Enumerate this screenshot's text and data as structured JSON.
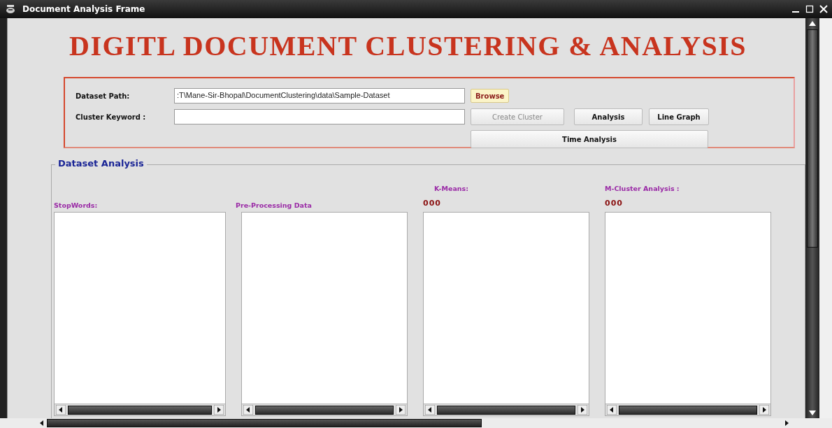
{
  "window": {
    "title": "Document Analysis Frame"
  },
  "heading": "DIGITL DOCUMENT CLUSTERING & ANALYSIS",
  "form": {
    "fields": [
      {
        "label": "Dataset Path:",
        "value": ":T\\Mane-Sir-Bhopal\\DocumentClustering\\data\\Sample-Dataset"
      },
      {
        "label": "Cluster Keyword :"
      }
    ],
    "buttons": [
      {
        "kind": "browse",
        "label": "Browse",
        "disabled": false
      },
      {
        "kind": "row",
        "label": "Create Cluster",
        "disabled": true
      },
      {
        "kind": "row",
        "label": "Analysis",
        "disabled": false
      },
      {
        "kind": "row",
        "label": "Line Graph",
        "disabled": false
      },
      {
        "kind": "wide",
        "label": "Time Analysis",
        "disabled": false
      }
    ]
  },
  "dataset_analysis": {
    "title": "Dataset Analysis",
    "columns": [
      {
        "kind": "caption",
        "label": "StopWords:"
      },
      {
        "kind": "caption",
        "label": "Pre-Processing Data"
      },
      {
        "kind": "count",
        "heading": "K-Means:",
        "count": "000"
      },
      {
        "kind": "count",
        "heading": "M-Cluster Analysis :",
        "count": "000"
      }
    ]
  }
}
